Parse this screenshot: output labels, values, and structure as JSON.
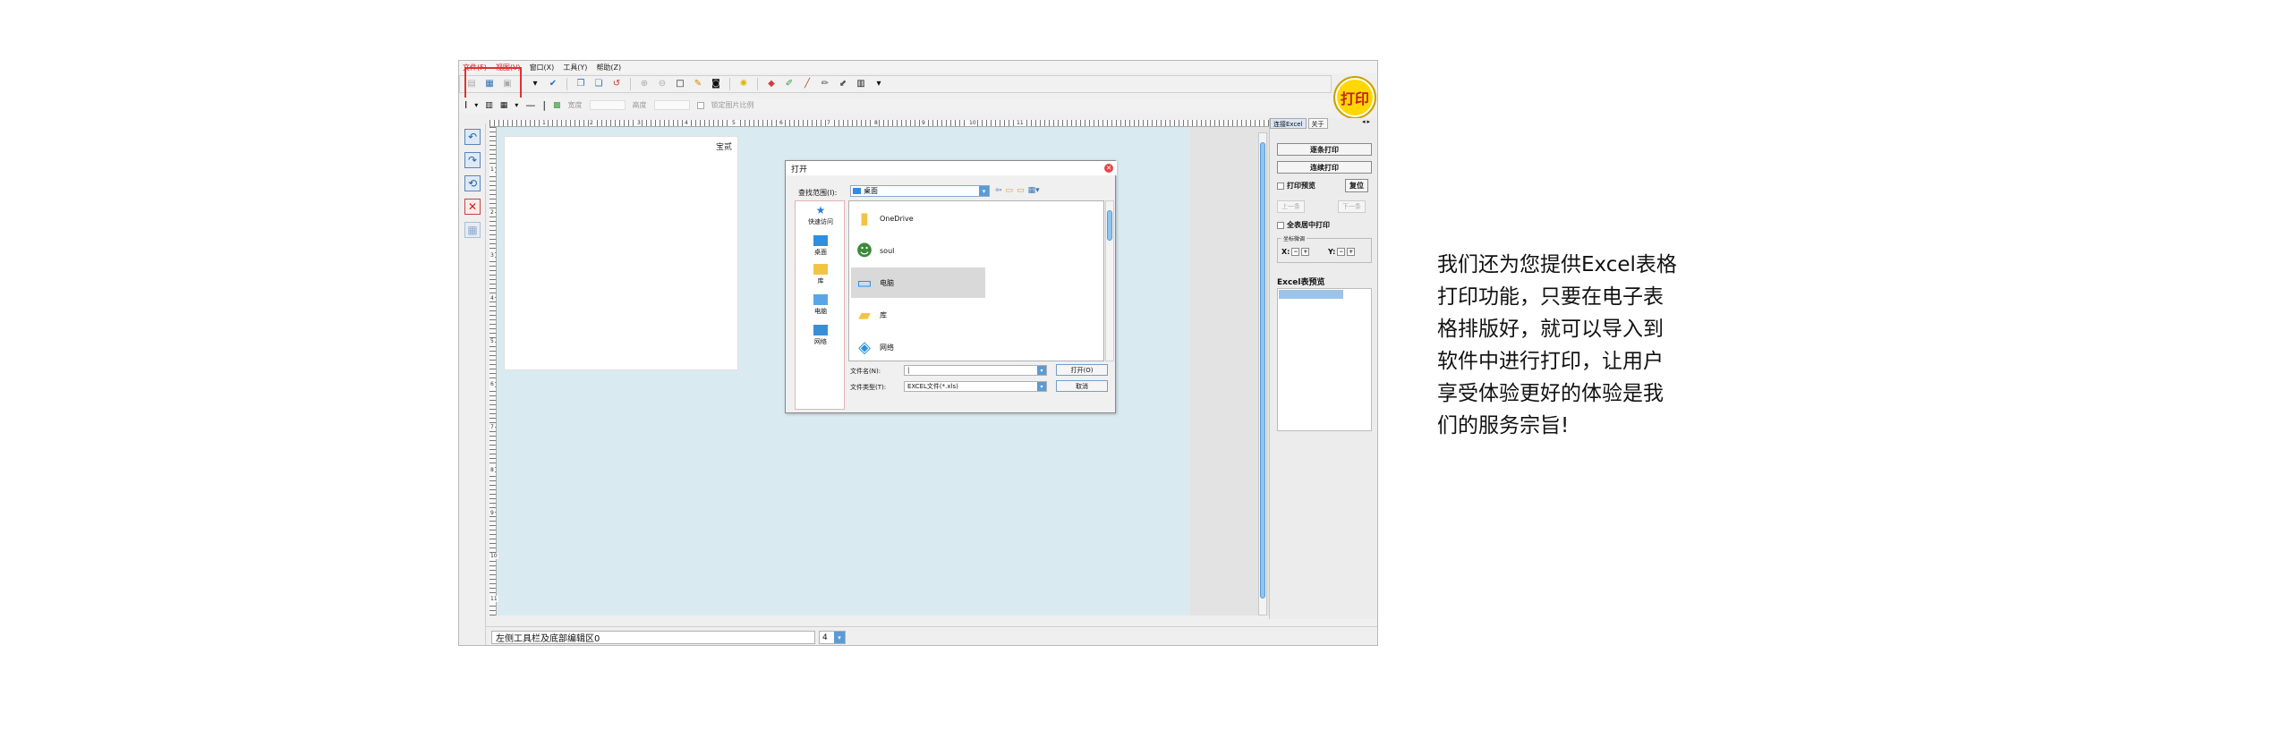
{
  "menu": {
    "file": "文件(F)",
    "view": "视图(V)",
    "window": "窗口(X)",
    "tools": "工具(Y)",
    "help": "帮助(Z)"
  },
  "toolbar2": {
    "width_label": "宽度",
    "height_label": "高度",
    "lock_ratio_label": "锁定图片比例"
  },
  "print_button": "打印",
  "ruler": {
    "top_labels": [
      "1",
      "2",
      "3",
      "4",
      "5",
      "6",
      "7",
      "8",
      "9",
      "10",
      "11"
    ],
    "left_labels": [
      "1",
      "2",
      "3",
      "4",
      "5",
      "6",
      "7",
      "8",
      "9",
      "10",
      "11"
    ]
  },
  "paper": {
    "label": "宝贰"
  },
  "dialog": {
    "title": "打开",
    "look_in_label": "查找范围(I):",
    "look_in_value": "桌面",
    "sidebar": [
      "快速访问",
      "桌面",
      "库",
      "电脑",
      "网络"
    ],
    "items": [
      "OneDrive",
      "soul",
      "电脑",
      "库",
      "网络"
    ],
    "filename_label": "文件名(N):",
    "filename_value": "|",
    "filetype_label": "文件类型(T):",
    "filetype_value": "EXCEL文件(*.xls)",
    "open_button": "打开(O)",
    "cancel_button": "取消"
  },
  "right_panel": {
    "tabs": [
      "连接Excel",
      "关于"
    ],
    "btn_one_by_one": "逐条打印",
    "btn_continuous": "连续打印",
    "print_preview": "打印预览",
    "reset": "复位",
    "prev": "上一条",
    "next": "下一条",
    "center_print": "全表居中打印",
    "fine_tune_title": "坐标微调",
    "x_label": "X:",
    "y_label": "Y:",
    "excel_preview_label": "Excel表预览"
  },
  "status": {
    "field_text": "左侧工具栏及底部编辑区0",
    "number": "4"
  },
  "caption": {
    "lines": [
      "我们还为您提供Excel表格",
      "打印功能，只要在电子表",
      "格排版好，就可以导入到",
      "软件中进行打印，让用户",
      "享受体验更好的体验是我",
      "们的服务宗旨!"
    ]
  },
  "colors": {
    "canvas_bg": "#daeaf1",
    "print_circle": "#ffd800",
    "highlight_box": "#e23030",
    "accent_blue": "#5b9bd5"
  }
}
